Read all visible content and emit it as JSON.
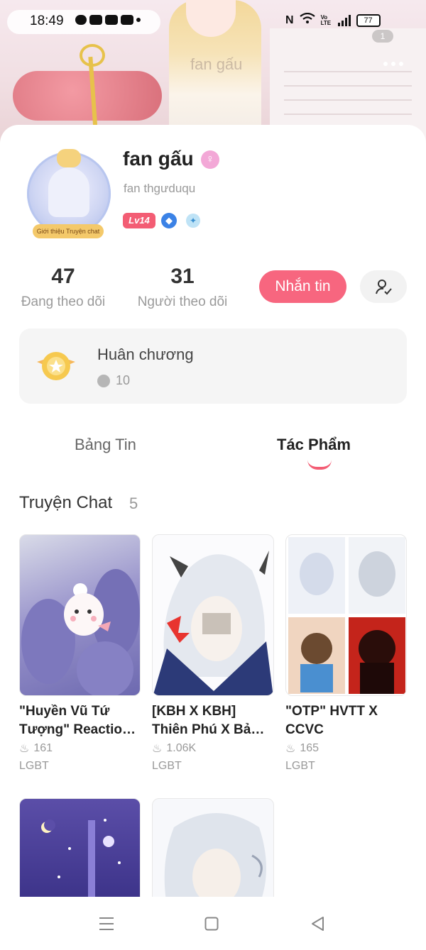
{
  "status_bar": {
    "time": "18:49",
    "battery": "77",
    "notification_count": "1",
    "network_label": "Vo LTE"
  },
  "banner": {
    "watermark": "fan gấu"
  },
  "profile": {
    "name": "fan gấu",
    "handle": "fan thgưduqu",
    "level": "Lv14",
    "frame_label": "Giới thiệu Truyện chat"
  },
  "stats": {
    "following_count": "47",
    "following_label": "Đang theo dõi",
    "followers_count": "31",
    "followers_label": "Người theo dõi"
  },
  "actions": {
    "message_label": "Nhắn tin"
  },
  "medals": {
    "title": "Huân chương",
    "count": "10"
  },
  "tabs": [
    {
      "label": "Bảng Tin",
      "active": false
    },
    {
      "label": "Tác Phẩm",
      "active": true
    }
  ],
  "section": {
    "title": "Truyện Chat",
    "count": "5"
  },
  "stories": [
    {
      "title_line1": "\"Huyền Vũ Tứ",
      "title_line2": "Tượng\" Reactio…",
      "views": "161",
      "genre": "LGBT"
    },
    {
      "title_line1": "[KBH X KBH]",
      "title_line2": "Thiên Phú X Bả…",
      "views": "1.06K",
      "genre": "LGBT"
    },
    {
      "title_line1": "\"OTP\" HVTT X",
      "title_line2": "CCVC",
      "views": "165",
      "genre": "LGBT"
    }
  ],
  "colors": {
    "accent": "#f7667f",
    "tab_underline": "#f35d74",
    "level_badge": "#f35d74",
    "gender_badge": "#f3a8d7"
  }
}
